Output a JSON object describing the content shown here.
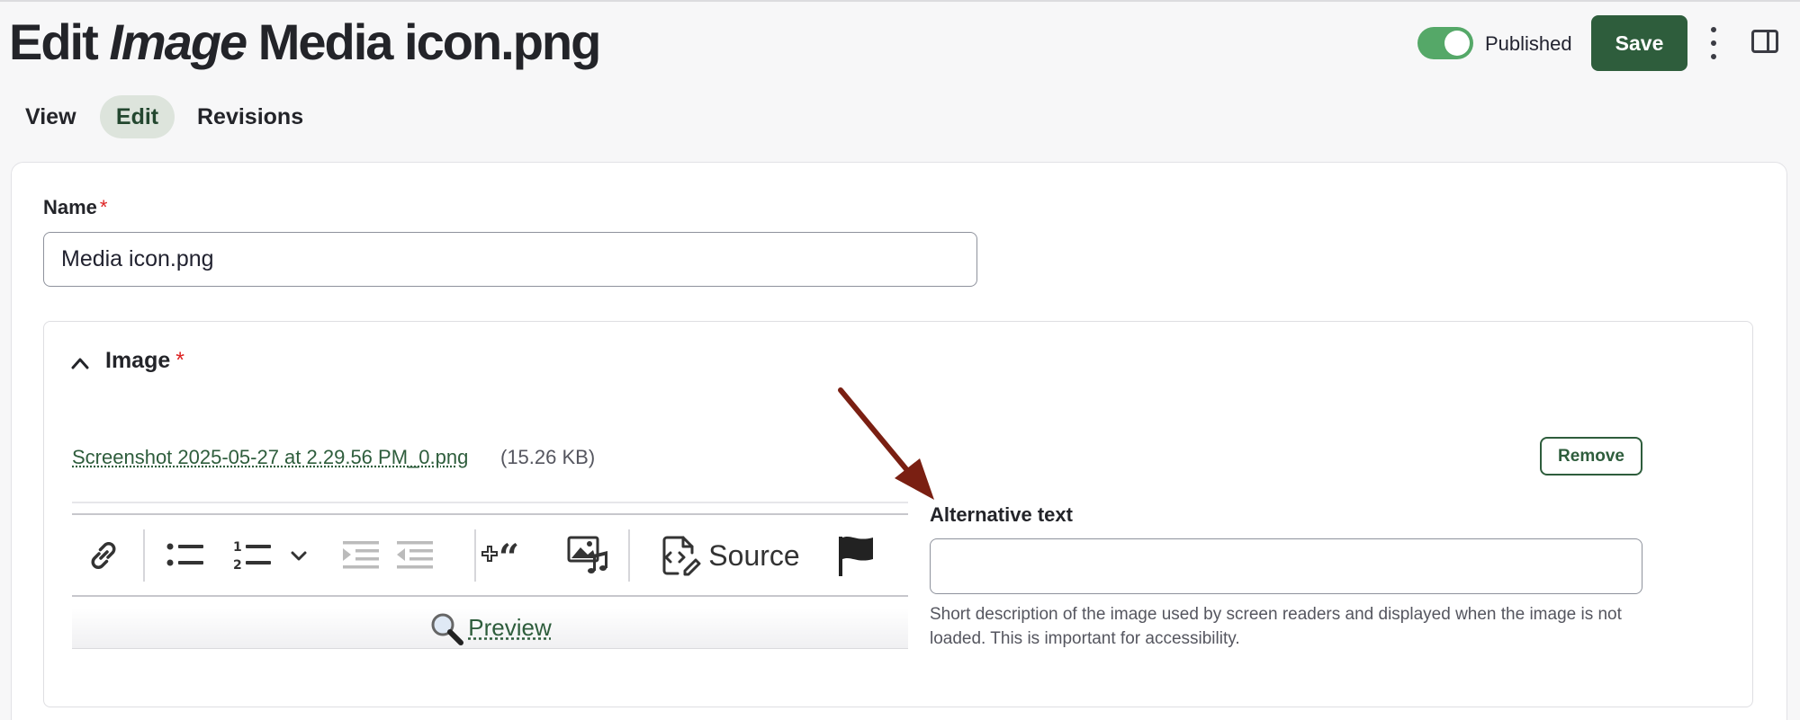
{
  "header": {
    "title_prefix": "Edit",
    "title_type": "Image",
    "title_name": "Media icon.png",
    "published_label": "Published",
    "published": true,
    "save_label": "Save"
  },
  "tabs": [
    {
      "label": "View",
      "active": false
    },
    {
      "label": "Edit",
      "active": true
    },
    {
      "label": "Revisions",
      "active": false
    }
  ],
  "form": {
    "name_label": "Name",
    "required_mark": "*",
    "name_value": "Media icon.png",
    "image_section_label": "Image",
    "file_link": "Screenshot 2025-05-27 at 2.29.56 PM_0.png",
    "file_size": "(15.26 KB)",
    "remove_label": "Remove",
    "alt_label": "Alternative text",
    "alt_value": "",
    "alt_description": "Short description of the image used by screen readers and displayed when the image is not loaded. This is important for accessibility."
  },
  "editor": {
    "toolbar_icons": [
      "link-icon",
      "bulleted-list-icon",
      "numbered-list-icon",
      "chevron-down-icon",
      "outdent-icon",
      "indent-icon",
      "blockquote-icon",
      "media-icon",
      "source-icon",
      "flag-icon"
    ],
    "source_label": "Source",
    "preview_label": "Preview"
  },
  "colors": {
    "accent": "#2e5d3c",
    "toggle_on": "#55a868",
    "required": "#dd2222",
    "annotation_arrow": "#7a1f12"
  }
}
